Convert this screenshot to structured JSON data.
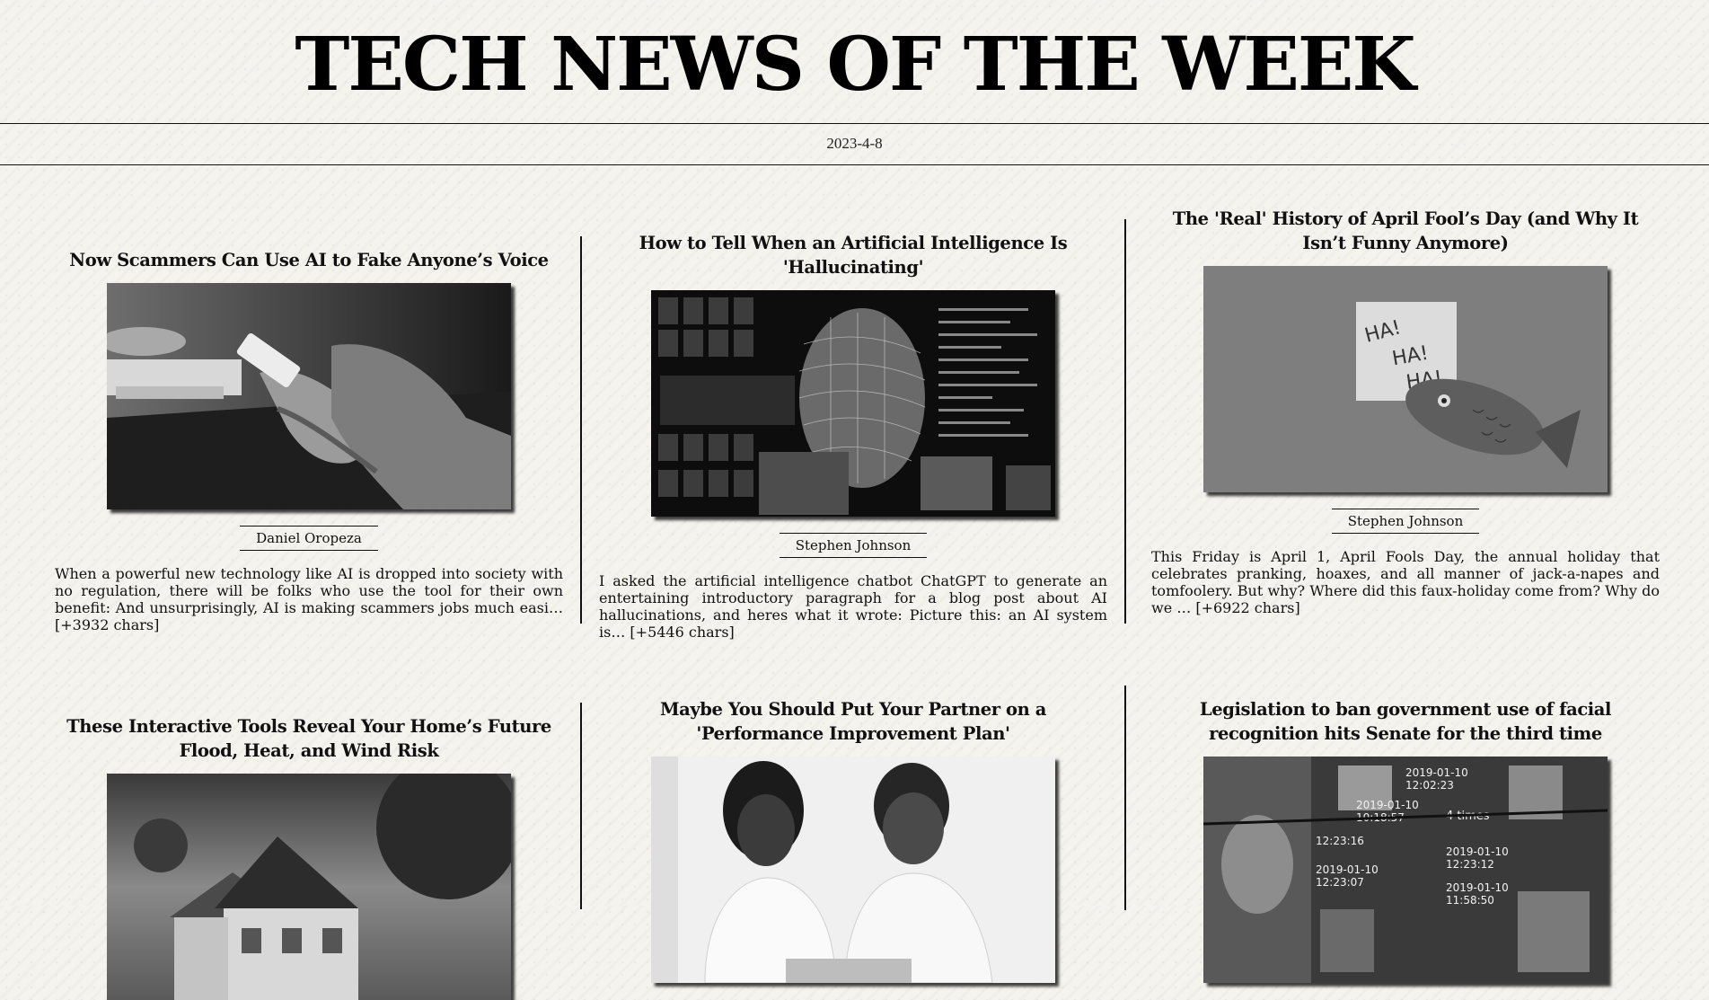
{
  "masthead": {
    "title": "TECH NEWS OF THE WEEK",
    "date": "2023-4-8"
  },
  "articles": [
    {
      "title": "Now Scammers Can Use AI to Fake Anyone’s Voice",
      "author": "Daniel Oropeza",
      "excerpt": "When a powerful new technology like AI is dropped into society with no regulation, there will be folks who use the tool for their own benefit: And unsurprisingly, AI is making scammers jobs much easi… [+3932 chars]",
      "image": "hands holding smartphone"
    },
    {
      "title": "How to Tell When an Artificial Intelligence Is 'Hallucinating'",
      "author": "Stephen Johnson",
      "excerpt": "I asked the artificial intelligence chatbot ChatGPT to generate an entertaining introductory paragraph for a blog post about AI hallucinations, and heres what it wrote: Picture this: an AI system is… [+5446 chars]",
      "image": "wireframe head with code"
    },
    {
      "title": "The 'Real' History of April Fool’s Day (and Why It Isn’t Funny Anymore)",
      "author": "Stephen Johnson",
      "excerpt": "This Friday is April 1, April Fools Day, the annual holiday that celebrates pranking, hoaxes, and all manner of jack-a-napes and tomfoolery. But why? Where did this faux-holiday come from? Why do we … [+6922 chars]",
      "image": "paper fish with note",
      "note_text": [
        "HA!",
        "HA!",
        "HA!"
      ]
    },
    {
      "title": "These Interactive Tools Reveal Your Home’s Future Flood, Heat, and Wind Risk",
      "image": "house under stormy sky"
    },
    {
      "title": "Maybe You Should Put Your Partner on a 'Performance Improvement Plan'",
      "image": "couple looking at laptop"
    },
    {
      "title": "Legislation to ban government use of facial recognition hits Senate for the third time",
      "image": "facial recognition collage",
      "overlay_text": [
        "2019-01-10",
        "12:02:23",
        "2019-01-10",
        "10:18:57",
        "2019-01-10",
        "12:23:16",
        "4 times",
        "2019-01-10",
        "12:23:12",
        "2019-01-10",
        "12:23:07",
        "2019-01-10",
        "11:58:50"
      ]
    }
  ]
}
